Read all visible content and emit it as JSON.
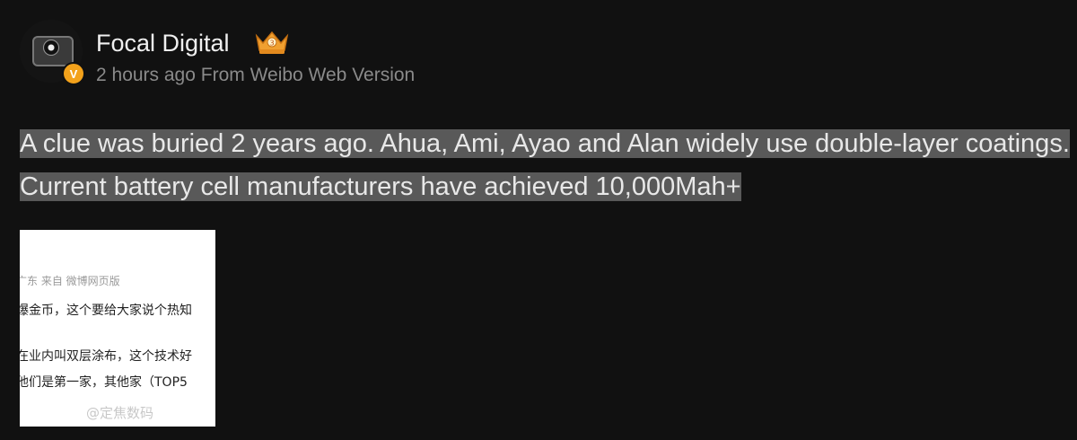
{
  "post": {
    "author": "Focal Digital",
    "verified_badge": "V",
    "meta": "2 hours ago From Weibo Web Version",
    "text": "A clue was buried 2 years ago. Ahua, Ami, Ayao and Alan widely use double-layer coatings. Current battery cell manufacturers have achieved 10,000Mah+",
    "highlight_color": "#595959",
    "badge_color": "#f3a21b",
    "icons": {
      "avatar": "camera-avatar",
      "crown": "crown-icon"
    }
  },
  "image": {
    "lines": [
      "广东 来自 微博网页版",
      "爆金币，这个要给大家说个热知",
      "在业内叫双层涂布，这个技术好",
      "他们是第一家，其他家（TOP5",
      "@定焦数码"
    ]
  }
}
